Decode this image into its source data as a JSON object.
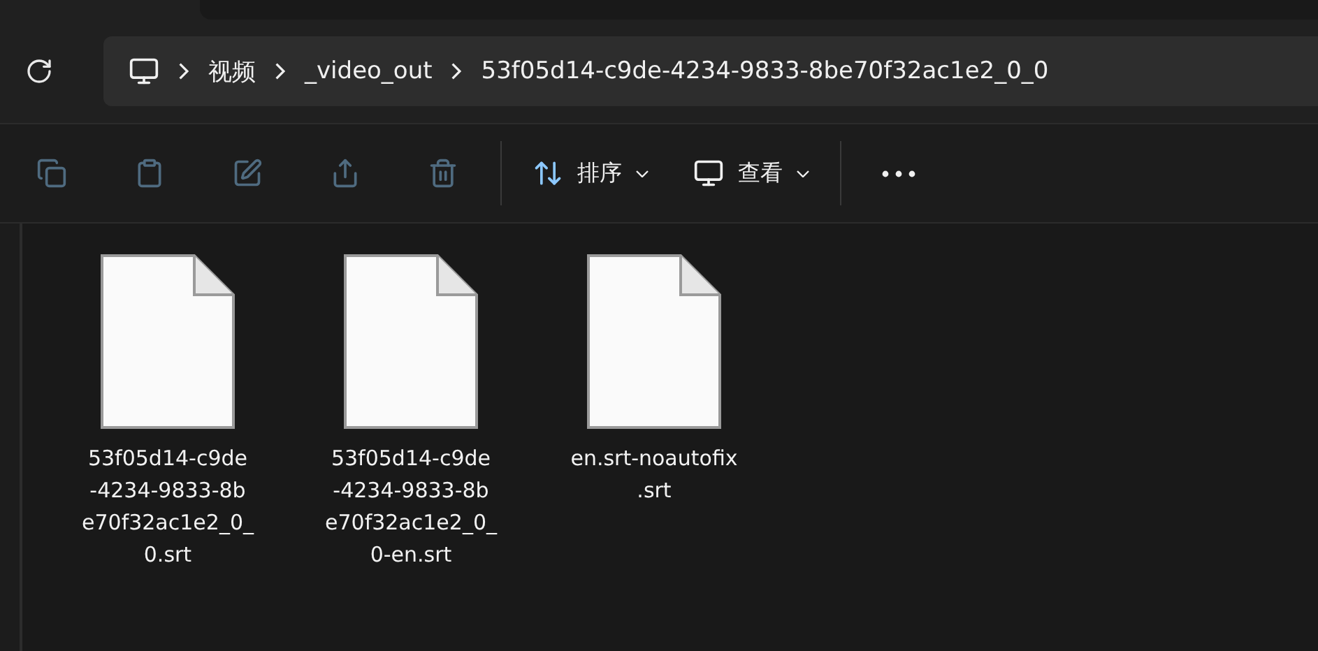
{
  "breadcrumb": [
    {
      "label": "视频"
    },
    {
      "label": "_video_out"
    },
    {
      "label": "53f05d14-c9de-4234-9833-8be70f32ac1e2_0_0"
    }
  ],
  "toolbar": [
    {
      "kind": "copy",
      "disabled": true
    },
    {
      "kind": "paste",
      "disabled": true
    },
    {
      "kind": "rename",
      "disabled": true
    },
    {
      "kind": "share",
      "disabled": true
    },
    {
      "kind": "delete",
      "disabled": true
    },
    {
      "kind": "sort",
      "label": "排序",
      "disabled": false
    },
    {
      "kind": "view",
      "label": "查看",
      "disabled": false
    },
    {
      "kind": "more",
      "disabled": false
    }
  ],
  "files": [
    {
      "name_lines": [
        "53f05d14-c9de",
        "-4234-9833-8b",
        "e70f32ac1e2_0_",
        "0.srt"
      ]
    },
    {
      "name_lines": [
        "53f05d14-c9de",
        "-4234-9833-8b",
        "e70f32ac1e2_0_",
        "0-en.srt"
      ]
    },
    {
      "name_lines": [
        "en.srt-noautofix",
        ".srt"
      ]
    }
  ]
}
